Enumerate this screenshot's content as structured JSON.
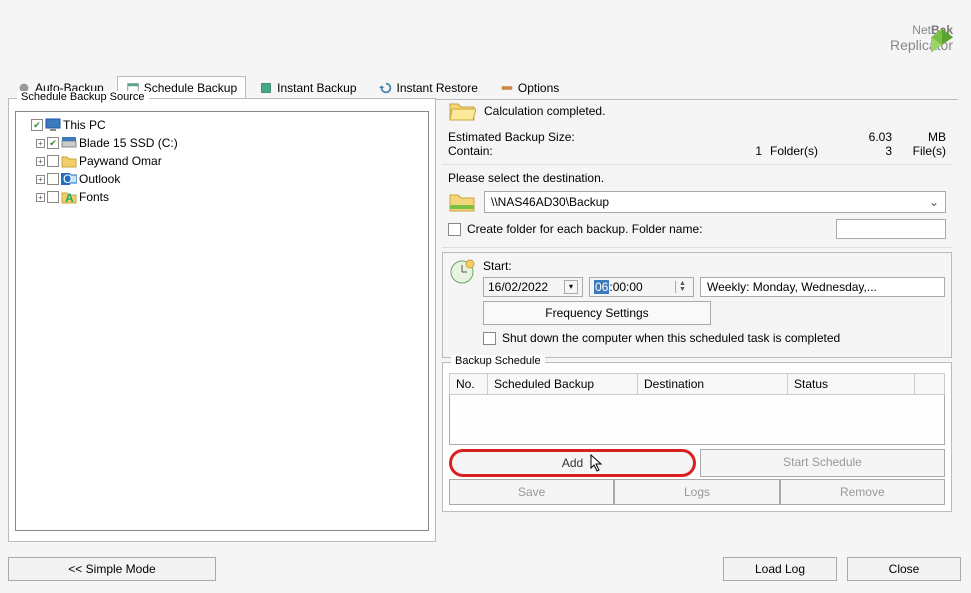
{
  "app": {
    "name_part1": "Net",
    "name_part2": "Bak",
    "subtitle": "Replicator"
  },
  "tabs": {
    "auto_backup": "Auto-Backup",
    "schedule_backup": "Schedule Backup",
    "instant_backup": "Instant Backup",
    "instant_restore": "Instant Restore",
    "options": "Options"
  },
  "source": {
    "title": "Schedule Backup Source",
    "items": {
      "this_pc": "This PC",
      "drive_c": "Blade 15 SSD (C:)",
      "user": "Paywand Omar",
      "outlook": "Outlook",
      "fonts": "Fonts"
    }
  },
  "calc": {
    "status": "Calculation completed.",
    "est_label": "Estimated Backup Size:",
    "est_value": "6.03",
    "est_unit": "MB",
    "contain_label": "Contain:",
    "folders_count": "1",
    "folders_label": "Folder(s)",
    "files_count": "3",
    "files_label": "File(s)"
  },
  "dest": {
    "prompt": "Please select the destination.",
    "path": "\\\\NAS46AD30\\Backup",
    "create_folder_label": "Create folder for each backup. Folder name:"
  },
  "schedule": {
    "start_label": "Start:",
    "date": "16/02/2022",
    "time_hh": "06",
    "time_rest": ":00:00",
    "recurrence": "Weekly: Monday, Wednesday,...",
    "freq_btn": "Frequency Settings",
    "shutdown_label": "Shut down the computer when this scheduled task is completed"
  },
  "table": {
    "title": "Backup Schedule",
    "col_no": "No.",
    "col_backup": "Scheduled Backup",
    "col_dest": "Destination",
    "col_status": "Status"
  },
  "buttons": {
    "add": "Add",
    "start": "Start Schedule",
    "save": "Save",
    "logs": "Logs",
    "remove": "Remove",
    "simple": "<< Simple Mode",
    "load_log": "Load Log",
    "close": "Close"
  }
}
